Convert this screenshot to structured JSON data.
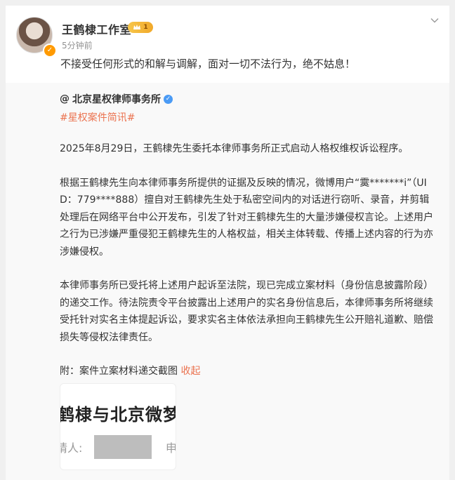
{
  "post": {
    "author": "王鹤棣工作室",
    "level": "1",
    "time": "5分钟前",
    "text": "不接受任何形式的和解与调解，面对一切不法行为，绝不姑息！"
  },
  "repost": {
    "mention": "北京星权律师事务所",
    "hashtag": "#星权案件简讯#",
    "paragraphs": [
      "2025年8月29日，王鹤棣先生委托本律师事务所正式启动人格权维权诉讼程序。",
      "根据王鹤棣先生向本律师事务所提供的证据及反映的情况，微博用户“霙*******i”（UID：779****888）擅自对王鹤棣先生处于私密空间内的对话进行窃听、录音，并剪辑处理后在网络平台中公开发布，引发了针对王鹤棣先生的大量涉嫌侵权言论。上述用户之行为已涉嫌严重侵犯王鹤棣先生的人格权益，相关主体转载、传播上述内容的行为亦涉嫌侵权。",
      "本律师事务所已受托将上述用户起诉至法院，现已完成立案材料（身份信息披露阶段）的递交工作。待法院责令平台披露出上述用户的实名身份信息后，本律师事务所将继续受托针对实名主体提起诉讼，要求实名主体依法承担向王鹤棣先生公开赔礼道歉、赔偿损失等侵权法律责任。"
    ],
    "attachment_label": "附：案件立案材料递交截图",
    "collapse": "收起",
    "image": {
      "title": "鹤棣与北京微梦",
      "label": "请人:",
      "tail": "申"
    }
  },
  "colors": {
    "link": "#eb7350",
    "verified_blue": "#4b9bf5",
    "verified_orange": "#ff9a00"
  }
}
